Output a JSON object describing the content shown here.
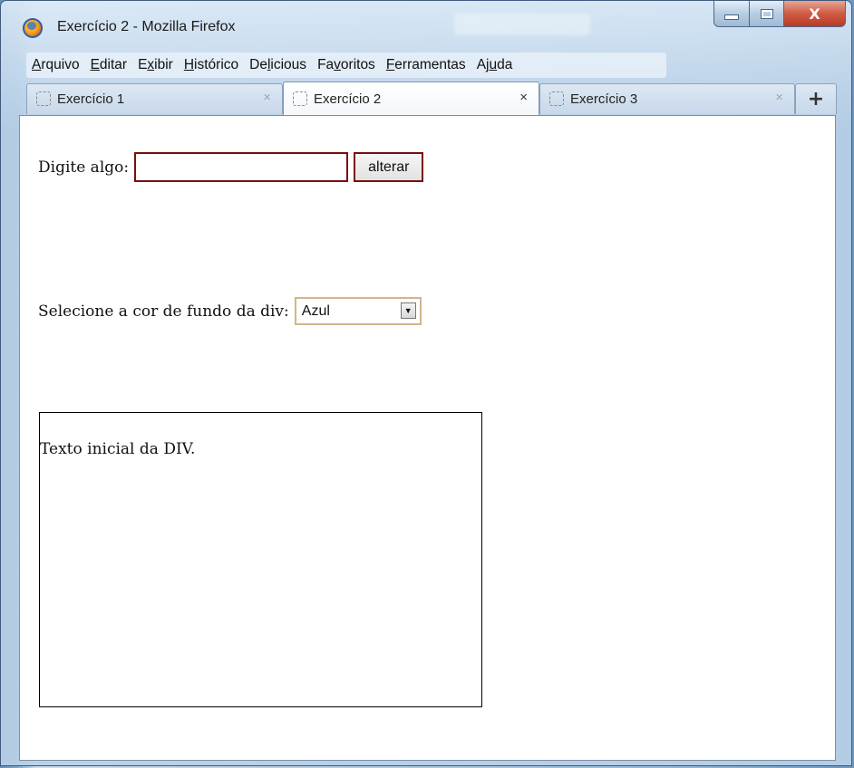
{
  "window": {
    "title": "Exercício 2 - Mozilla Firefox",
    "controls": {
      "minimize": "minimize",
      "maximize": "maximize",
      "close": "X"
    }
  },
  "menu": {
    "items": [
      {
        "label": "Arquivo"
      },
      {
        "label": "Editar"
      },
      {
        "label": "Exibir"
      },
      {
        "label": "Histórico"
      },
      {
        "label": "Delicious"
      },
      {
        "label": "Favoritos"
      },
      {
        "label": "Ferramentas"
      },
      {
        "label": "Ajuda"
      }
    ]
  },
  "tabs": [
    {
      "label": "Exercício 1",
      "active": false,
      "close": "×"
    },
    {
      "label": "Exercício 2",
      "active": true,
      "close": "×"
    },
    {
      "label": "Exercício 3",
      "active": false,
      "close": "×"
    }
  ],
  "new_tab_label": "+",
  "page": {
    "input_label": "Digite algo:",
    "input_value": "",
    "button_label": "alterar",
    "select_label": "Selecione a cor de fundo da div:",
    "select_value": "Azul",
    "div_text": "Texto inicial da DIV."
  },
  "colors": {
    "input_border": "#7a0e0e",
    "select_border": "#d2b48c",
    "close_button": "#cf5b43"
  }
}
